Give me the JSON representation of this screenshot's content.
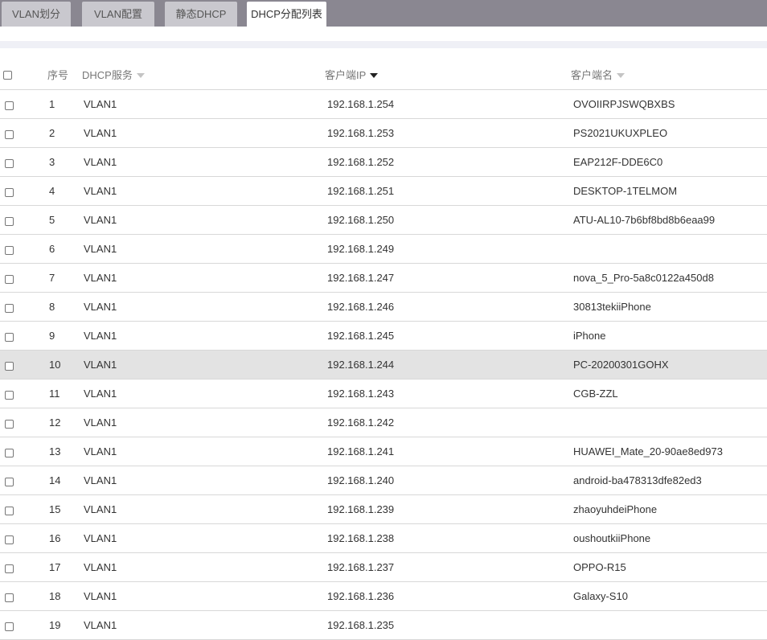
{
  "tabs": [
    {
      "label": "VLAN划分",
      "active": false
    },
    {
      "label": "VLAN配置",
      "active": false
    },
    {
      "label": "静态DHCP",
      "active": false
    },
    {
      "label": "DHCP分配列表",
      "active": true
    }
  ],
  "table": {
    "columns": {
      "index": "序号",
      "service": "DHCP服务",
      "client_ip": "客户端IP",
      "client_name": "客户端名"
    },
    "sort_column": "client_ip",
    "highlighted_row": "10",
    "rows": [
      {
        "no": "1",
        "service": "VLAN1",
        "ip": "192.168.1.254",
        "name": "OVOIIRPJSWQBXBS"
      },
      {
        "no": "2",
        "service": "VLAN1",
        "ip": "192.168.1.253",
        "name": "PS2021UKUXPLEO"
      },
      {
        "no": "3",
        "service": "VLAN1",
        "ip": "192.168.1.252",
        "name": "EAP212F-DDE6C0"
      },
      {
        "no": "4",
        "service": "VLAN1",
        "ip": "192.168.1.251",
        "name": "DESKTOP-1TELMOM"
      },
      {
        "no": "5",
        "service": "VLAN1",
        "ip": "192.168.1.250",
        "name": "ATU-AL10-7b6bf8bd8b6eaa99"
      },
      {
        "no": "6",
        "service": "VLAN1",
        "ip": "192.168.1.249",
        "name": ""
      },
      {
        "no": "7",
        "service": "VLAN1",
        "ip": "192.168.1.247",
        "name": "nova_5_Pro-5a8c0122a450d8"
      },
      {
        "no": "8",
        "service": "VLAN1",
        "ip": "192.168.1.246",
        "name": "30813tekiiPhone"
      },
      {
        "no": "9",
        "service": "VLAN1",
        "ip": "192.168.1.245",
        "name": "iPhone"
      },
      {
        "no": "10",
        "service": "VLAN1",
        "ip": "192.168.1.244",
        "name": "PC-20200301GOHX"
      },
      {
        "no": "11",
        "service": "VLAN1",
        "ip": "192.168.1.243",
        "name": "CGB-ZZL"
      },
      {
        "no": "12",
        "service": "VLAN1",
        "ip": "192.168.1.242",
        "name": ""
      },
      {
        "no": "13",
        "service": "VLAN1",
        "ip": "192.168.1.241",
        "name": "HUAWEI_Mate_20-90ae8ed973"
      },
      {
        "no": "14",
        "service": "VLAN1",
        "ip": "192.168.1.240",
        "name": "android-ba478313dfe82ed3"
      },
      {
        "no": "15",
        "service": "VLAN1",
        "ip": "192.168.1.239",
        "name": "zhaoyuhdeiPhone"
      },
      {
        "no": "16",
        "service": "VLAN1",
        "ip": "192.168.1.238",
        "name": "oushoutkiiPhone"
      },
      {
        "no": "17",
        "service": "VLAN1",
        "ip": "192.168.1.237",
        "name": "OPPO-R15"
      },
      {
        "no": "18",
        "service": "VLAN1",
        "ip": "192.168.1.236",
        "name": "Galaxy-S10"
      },
      {
        "no": "19",
        "service": "VLAN1",
        "ip": "192.168.1.235",
        "name": ""
      }
    ]
  }
}
